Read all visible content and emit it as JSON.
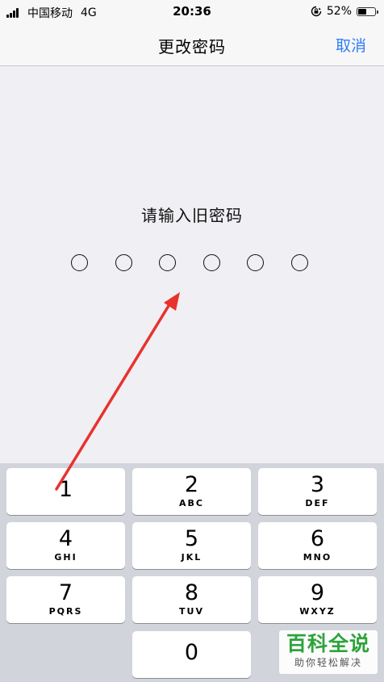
{
  "status_bar": {
    "carrier": "中国移动",
    "network": "4G",
    "time": "20:36",
    "battery_percent": "52%",
    "battery_level": 0.52,
    "icons": [
      "signal-icon",
      "orientation-lock-icon",
      "battery-icon"
    ]
  },
  "nav": {
    "title": "更改密码",
    "cancel_label": "取消"
  },
  "prompt": "请输入旧密码",
  "passcode_length": 6,
  "keypad": {
    "keys": [
      {
        "digit": "1",
        "letters": ""
      },
      {
        "digit": "2",
        "letters": "ABC"
      },
      {
        "digit": "3",
        "letters": "DEF"
      },
      {
        "digit": "4",
        "letters": "GHI"
      },
      {
        "digit": "5",
        "letters": "JKL"
      },
      {
        "digit": "6",
        "letters": "MNO"
      },
      {
        "digit": "7",
        "letters": "PQRS"
      },
      {
        "digit": "8",
        "letters": "TUV"
      },
      {
        "digit": "9",
        "letters": "WXYZ"
      },
      {
        "digit": "0",
        "letters": ""
      }
    ]
  },
  "watermark": {
    "title": "百科全说",
    "subtitle": "助你轻松解决"
  },
  "colors": {
    "accent": "#2f7ef6",
    "annotation_arrow": "#e8322d",
    "watermark_green": "#2da33b"
  }
}
